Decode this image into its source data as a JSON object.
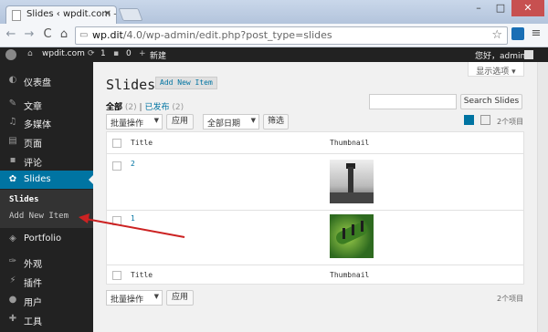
{
  "browser": {
    "tab_title": "Slides ‹ wpdit.com — W",
    "url_host": "wp.dit",
    "url_path": "/4.0/wp-admin/edit.php?post_type=slides"
  },
  "adminbar": {
    "site_name": "wpdit.com",
    "updates_count": "1",
    "comments_count": "0",
    "new_label": "新建",
    "greeting": "您好，admin"
  },
  "sidebar": {
    "items": [
      {
        "label": "仪表盘",
        "icon": "dashboard-icon"
      },
      {
        "label": "文章",
        "icon": "pin-icon"
      },
      {
        "label": "多媒体",
        "icon": "media-icon"
      },
      {
        "label": "页面",
        "icon": "page-icon"
      },
      {
        "label": "评论",
        "icon": "comment-icon"
      },
      {
        "label": "Slides",
        "icon": "slides-icon"
      },
      {
        "label": "Portfolio",
        "icon": "portfolio-icon"
      },
      {
        "label": "外观",
        "icon": "brush-icon"
      },
      {
        "label": "插件",
        "icon": "plugin-icon"
      },
      {
        "label": "用户",
        "icon": "user-icon"
      },
      {
        "label": "工具",
        "icon": "wrench-icon"
      }
    ],
    "submenu": [
      "Slides",
      "Add New Item"
    ]
  },
  "screen_options": "显示选项 ▾",
  "page": {
    "title": "Slides",
    "add_new": "Add New Item"
  },
  "filters": {
    "all_label": "全部",
    "all_count": "(2)",
    "separator": "|",
    "published_label": "已发布",
    "published_count": "(2)"
  },
  "search_button": "Search Slides",
  "bulk_actions": "批量操作",
  "apply": "应用",
  "all_dates": "全部日期",
  "filter_button": "筛选",
  "item_count": "2个项目",
  "table": {
    "columns": [
      "Title",
      "Thumbnail"
    ],
    "rows": [
      {
        "title": "2",
        "thumbnail": "lighthouse"
      },
      {
        "title": "1",
        "thumbnail": "caterpillar"
      }
    ]
  },
  "colors": {
    "accent": "#0074a2",
    "admin_bar": "#222222",
    "arrow": "#cc2222"
  }
}
